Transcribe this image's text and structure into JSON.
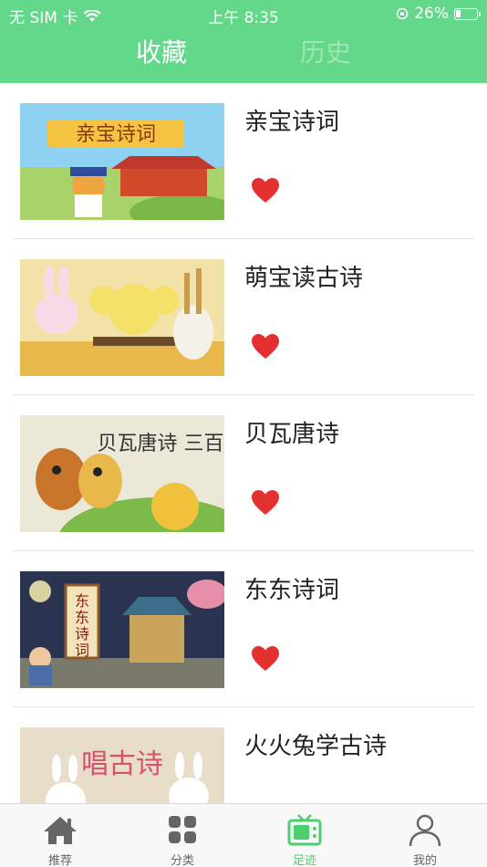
{
  "status_bar": {
    "carrier": "无 SIM 卡",
    "time": "上午 8:35",
    "battery": "26%",
    "battery_level": 0.26
  },
  "top_tabs": [
    {
      "label": "收藏",
      "active": true
    },
    {
      "label": "历史",
      "active": false
    }
  ],
  "favorites": [
    {
      "title": "亲宝诗词",
      "thumb_text": "亲宝诗词",
      "favorited": true
    },
    {
      "title": "萌宝读古诗",
      "thumb_text": "",
      "favorited": true
    },
    {
      "title": "贝瓦唐诗",
      "thumb_text": "贝瓦唐诗 三百首",
      "favorited": true
    },
    {
      "title": "东东诗词",
      "thumb_text": "东东诗词",
      "favorited": true
    },
    {
      "title": "火火兔学古诗",
      "thumb_text": "唱古诗",
      "favorited": true
    }
  ],
  "tab_bar": [
    {
      "label": "推荐",
      "icon": "home-icon",
      "active": false
    },
    {
      "label": "分类",
      "icon": "grid-icon",
      "active": false
    },
    {
      "label": "足迹",
      "icon": "tv-icon",
      "active": true
    },
    {
      "label": "我的",
      "icon": "user-icon",
      "active": false
    }
  ],
  "colors": {
    "header": "#63d88a",
    "heart": "#e53030",
    "active_tab": "#4cd06e"
  }
}
